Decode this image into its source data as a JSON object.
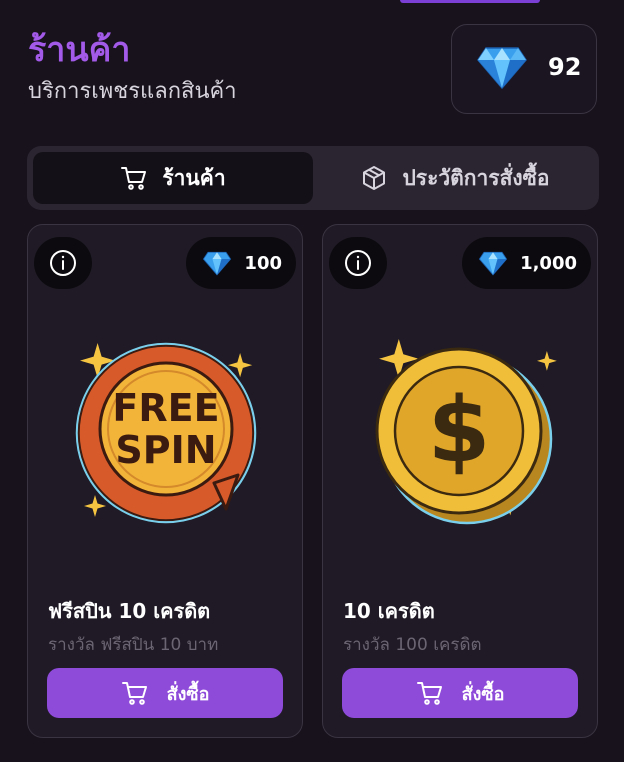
{
  "header": {
    "title": "ร้านค้า",
    "subtitle": "บริการเพชรแลกสินค้า"
  },
  "balance": {
    "icon": "diamond-icon",
    "value": "92"
  },
  "tabs": [
    {
      "label": "ร้านค้า",
      "icon": "cart-icon",
      "active": true
    },
    {
      "label": "ประวัติการสั่งซื้อ",
      "icon": "box-icon",
      "active": false
    }
  ],
  "products": [
    {
      "price": "100",
      "art": "free-spin-icon",
      "art_text": [
        "FREE",
        "SPIN"
      ],
      "title": "ฟรีสปิน 10 เครดิต",
      "description": "รางวัล ฟรีสปิน 10 บาท",
      "buy_label": "สั่งซื้อ"
    },
    {
      "price": "1,000",
      "art": "gold-coin-icon",
      "art_text": [
        "$"
      ],
      "title": "10 เครดิต",
      "description": "รางวัล 100 เครดิต",
      "buy_label": "สั่งซื้อ"
    }
  ],
  "colors": {
    "accent": "#8e4ad9",
    "title": "#a35ae8",
    "background": "#17121c",
    "card": "#1f1a25"
  }
}
